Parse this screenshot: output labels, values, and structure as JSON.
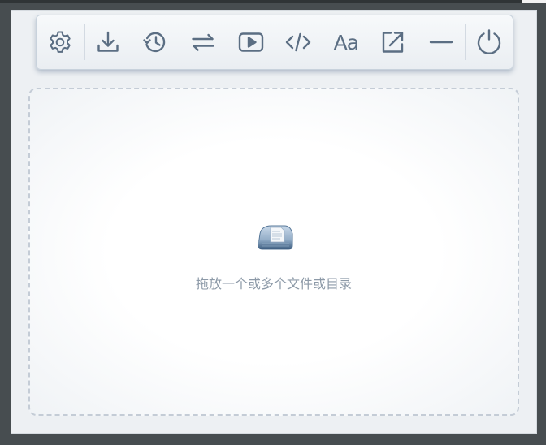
{
  "toolbar": {
    "buttons": [
      {
        "id": "settings",
        "icon": "gear-icon"
      },
      {
        "id": "download",
        "icon": "download-icon"
      },
      {
        "id": "history",
        "icon": "history-icon"
      },
      {
        "id": "swap",
        "icon": "swap-arrows-icon"
      },
      {
        "id": "play",
        "icon": "play-icon"
      },
      {
        "id": "code",
        "icon": "code-icon"
      },
      {
        "id": "font",
        "icon": "font-icon",
        "label": "Aa"
      },
      {
        "id": "export",
        "icon": "export-icon"
      },
      {
        "id": "minimize",
        "icon": "minimize-icon"
      },
      {
        "id": "power",
        "icon": "power-icon"
      }
    ],
    "icon_color": "#5b6e83"
  },
  "dropzone": {
    "icon": "drive-icon",
    "text": "拖放一个或多个文件或目录"
  }
}
